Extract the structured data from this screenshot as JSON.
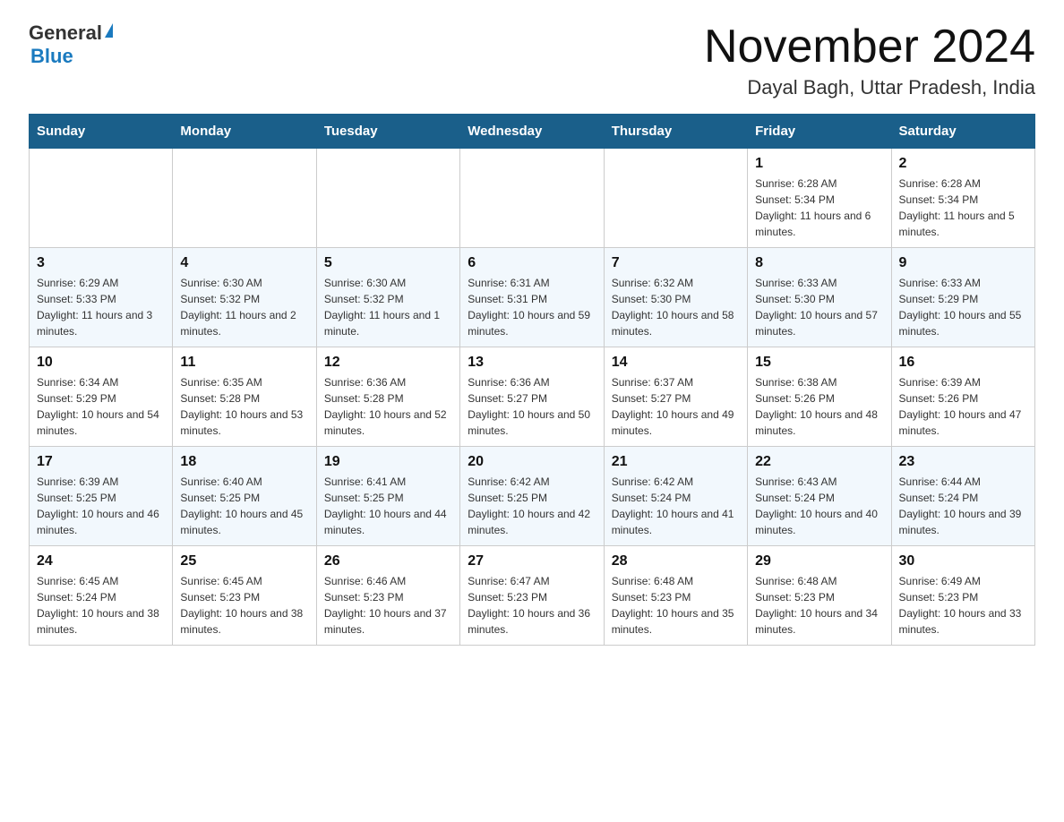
{
  "logo": {
    "text_general": "General",
    "text_blue": "Blue",
    "arrow": "▶"
  },
  "title": {
    "month": "November 2024",
    "location": "Dayal Bagh, Uttar Pradesh, India"
  },
  "weekdays": [
    "Sunday",
    "Monday",
    "Tuesday",
    "Wednesday",
    "Thursday",
    "Friday",
    "Saturday"
  ],
  "weeks": [
    [
      {
        "day": "",
        "info": ""
      },
      {
        "day": "",
        "info": ""
      },
      {
        "day": "",
        "info": ""
      },
      {
        "day": "",
        "info": ""
      },
      {
        "day": "",
        "info": ""
      },
      {
        "day": "1",
        "info": "Sunrise: 6:28 AM\nSunset: 5:34 PM\nDaylight: 11 hours and 6 minutes."
      },
      {
        "day": "2",
        "info": "Sunrise: 6:28 AM\nSunset: 5:34 PM\nDaylight: 11 hours and 5 minutes."
      }
    ],
    [
      {
        "day": "3",
        "info": "Sunrise: 6:29 AM\nSunset: 5:33 PM\nDaylight: 11 hours and 3 minutes."
      },
      {
        "day": "4",
        "info": "Sunrise: 6:30 AM\nSunset: 5:32 PM\nDaylight: 11 hours and 2 minutes."
      },
      {
        "day": "5",
        "info": "Sunrise: 6:30 AM\nSunset: 5:32 PM\nDaylight: 11 hours and 1 minute."
      },
      {
        "day": "6",
        "info": "Sunrise: 6:31 AM\nSunset: 5:31 PM\nDaylight: 10 hours and 59 minutes."
      },
      {
        "day": "7",
        "info": "Sunrise: 6:32 AM\nSunset: 5:30 PM\nDaylight: 10 hours and 58 minutes."
      },
      {
        "day": "8",
        "info": "Sunrise: 6:33 AM\nSunset: 5:30 PM\nDaylight: 10 hours and 57 minutes."
      },
      {
        "day": "9",
        "info": "Sunrise: 6:33 AM\nSunset: 5:29 PM\nDaylight: 10 hours and 55 minutes."
      }
    ],
    [
      {
        "day": "10",
        "info": "Sunrise: 6:34 AM\nSunset: 5:29 PM\nDaylight: 10 hours and 54 minutes."
      },
      {
        "day": "11",
        "info": "Sunrise: 6:35 AM\nSunset: 5:28 PM\nDaylight: 10 hours and 53 minutes."
      },
      {
        "day": "12",
        "info": "Sunrise: 6:36 AM\nSunset: 5:28 PM\nDaylight: 10 hours and 52 minutes."
      },
      {
        "day": "13",
        "info": "Sunrise: 6:36 AM\nSunset: 5:27 PM\nDaylight: 10 hours and 50 minutes."
      },
      {
        "day": "14",
        "info": "Sunrise: 6:37 AM\nSunset: 5:27 PM\nDaylight: 10 hours and 49 minutes."
      },
      {
        "day": "15",
        "info": "Sunrise: 6:38 AM\nSunset: 5:26 PM\nDaylight: 10 hours and 48 minutes."
      },
      {
        "day": "16",
        "info": "Sunrise: 6:39 AM\nSunset: 5:26 PM\nDaylight: 10 hours and 47 minutes."
      }
    ],
    [
      {
        "day": "17",
        "info": "Sunrise: 6:39 AM\nSunset: 5:25 PM\nDaylight: 10 hours and 46 minutes."
      },
      {
        "day": "18",
        "info": "Sunrise: 6:40 AM\nSunset: 5:25 PM\nDaylight: 10 hours and 45 minutes."
      },
      {
        "day": "19",
        "info": "Sunrise: 6:41 AM\nSunset: 5:25 PM\nDaylight: 10 hours and 44 minutes."
      },
      {
        "day": "20",
        "info": "Sunrise: 6:42 AM\nSunset: 5:25 PM\nDaylight: 10 hours and 42 minutes."
      },
      {
        "day": "21",
        "info": "Sunrise: 6:42 AM\nSunset: 5:24 PM\nDaylight: 10 hours and 41 minutes."
      },
      {
        "day": "22",
        "info": "Sunrise: 6:43 AM\nSunset: 5:24 PM\nDaylight: 10 hours and 40 minutes."
      },
      {
        "day": "23",
        "info": "Sunrise: 6:44 AM\nSunset: 5:24 PM\nDaylight: 10 hours and 39 minutes."
      }
    ],
    [
      {
        "day": "24",
        "info": "Sunrise: 6:45 AM\nSunset: 5:24 PM\nDaylight: 10 hours and 38 minutes."
      },
      {
        "day": "25",
        "info": "Sunrise: 6:45 AM\nSunset: 5:23 PM\nDaylight: 10 hours and 38 minutes."
      },
      {
        "day": "26",
        "info": "Sunrise: 6:46 AM\nSunset: 5:23 PM\nDaylight: 10 hours and 37 minutes."
      },
      {
        "day": "27",
        "info": "Sunrise: 6:47 AM\nSunset: 5:23 PM\nDaylight: 10 hours and 36 minutes."
      },
      {
        "day": "28",
        "info": "Sunrise: 6:48 AM\nSunset: 5:23 PM\nDaylight: 10 hours and 35 minutes."
      },
      {
        "day": "29",
        "info": "Sunrise: 6:48 AM\nSunset: 5:23 PM\nDaylight: 10 hours and 34 minutes."
      },
      {
        "day": "30",
        "info": "Sunrise: 6:49 AM\nSunset: 5:23 PM\nDaylight: 10 hours and 33 minutes."
      }
    ]
  ]
}
